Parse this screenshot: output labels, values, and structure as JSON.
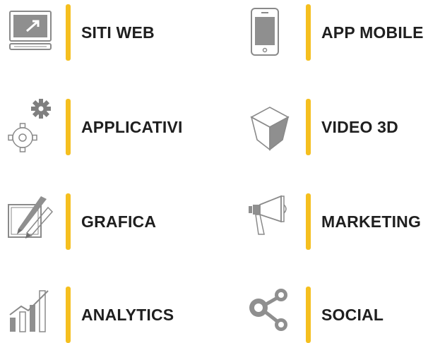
{
  "accent_color": "#f5bf1f",
  "icon_color": "#8a8a8a",
  "services": [
    {
      "label": "SITI WEB",
      "icon": "monitor-icon"
    },
    {
      "label": "APP MOBILE",
      "icon": "smartphone-icon"
    },
    {
      "label": "APPLICATIVI",
      "icon": "gears-icon"
    },
    {
      "label": "VIDEO 3D",
      "icon": "cube-icon"
    },
    {
      "label": "GRAFICA",
      "icon": "pen-brush-icon"
    },
    {
      "label": "MARKETING",
      "icon": "megaphone-icon"
    },
    {
      "label": "ANALYTICS",
      "icon": "bar-chart-icon"
    },
    {
      "label": "SOCIAL",
      "icon": "share-nodes-icon"
    }
  ]
}
